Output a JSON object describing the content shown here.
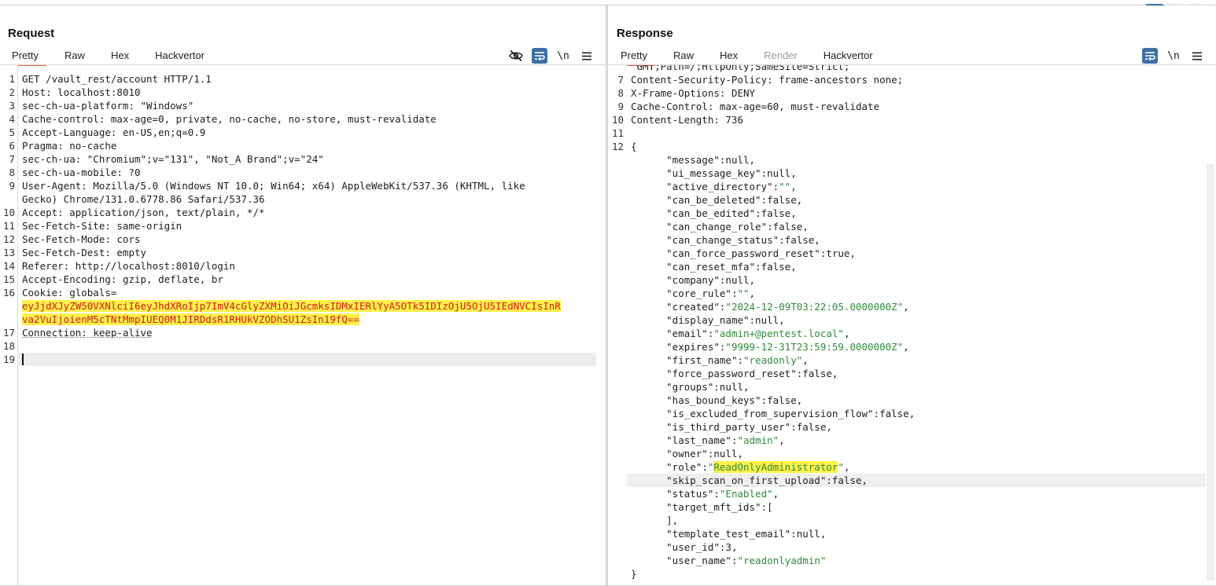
{
  "view_selector": {
    "options": [
      "split-vertical",
      "split-horizontal",
      "single"
    ],
    "active": "split-vertical"
  },
  "request": {
    "title": "Request",
    "tabs": [
      {
        "label": "Pretty",
        "active": true
      },
      {
        "label": "Raw"
      },
      {
        "label": "Hex"
      },
      {
        "label": "Hackvertor"
      }
    ],
    "tools": {
      "hide_icon": "eye-off-icon",
      "wrap_icon": "wrap-lines-icon",
      "newline_label": "\\n",
      "menu_icon": "hamburger-menu-icon"
    },
    "lines": [
      {
        "n": "1",
        "text": "GET /vault_rest/account HTTP/1.1"
      },
      {
        "n": "2",
        "key": "Host",
        "val": ": localhost:8010"
      },
      {
        "n": "3",
        "key": "sec-ch-ua-platform",
        "val": ": \"Windows\""
      },
      {
        "n": "4",
        "key": "Cache-control",
        "val": ": max-age=0, private, no-cache, no-store, must-revalidate"
      },
      {
        "n": "5",
        "key": "Accept-Language",
        "val": ": en-US,en;q=0.9"
      },
      {
        "n": "6",
        "key": "Pragma",
        "val": ": no-cache"
      },
      {
        "n": "7",
        "key": "sec-ch-ua",
        "val": ": \"Chromium\";v=\"131\", \"Not_A Brand\";v=\"24\""
      },
      {
        "n": "8",
        "key": "sec-ch-ua-mobile",
        "val": ": ?0"
      },
      {
        "n": "9",
        "key": "User-Agent",
        "val": ": Mozilla/5.0 (Windows NT 10.0; Win64; x64) AppleWebKit/537.36 (KHTML, like"
      },
      {
        "n": "",
        "text": "Gecko) Chrome/131.0.6778.86 Safari/537.36"
      },
      {
        "n": "10",
        "key": "Accept",
        "val": ": application/json, text/plain, */*"
      },
      {
        "n": "11",
        "key": "Sec-Fetch-Site",
        "val": ": same-origin"
      },
      {
        "n": "12",
        "key": "Sec-Fetch-Mode",
        "val": ": cors"
      },
      {
        "n": "13",
        "key": "Sec-Fetch-Dest",
        "val": ": empty"
      },
      {
        "n": "14",
        "key": "Referer",
        "val": ": http://localhost:8010/login"
      },
      {
        "n": "15",
        "key": "Accept-Encoding",
        "val": ": gzip, deflate, br"
      },
      {
        "n": "16",
        "key": "Cookie",
        "val": ": globals="
      },
      {
        "n": "",
        "cookie": "eyJjdXJyZW50VXNlciI6eyJhdXRoIjp7ImV4cGlyZXMiOiJGcmksIDMxIERlYyA5OTk5IDIzOjU5OjU5IEdNVCIsInR"
      },
      {
        "n": "",
        "cookie": "va2VuIjoienM5cTNtMmpIUEQ0M1JIRDdsR1RHUkVZODhSU1ZsIn19fQ=="
      },
      {
        "n": "17",
        "key": "Connection",
        "val": ": keep-alive",
        "underline": true
      },
      {
        "n": "18",
        "text": ""
      },
      {
        "n": "19",
        "text": "",
        "current": true
      }
    ]
  },
  "response": {
    "title": "Response",
    "tabs": [
      {
        "label": "Pretty",
        "active": true
      },
      {
        "label": "Raw"
      },
      {
        "label": "Hex"
      },
      {
        "label": "Render",
        "disabled": true
      },
      {
        "label": "Hackvertor"
      }
    ],
    "tools": {
      "wrap_icon": "wrap-lines-icon",
      "newline_label": "\\n",
      "menu_icon": "hamburger-menu-icon"
    },
    "lines": [
      {
        "n": "",
        "text": " GMT;Path=/;HttpOnly;SameSite=Strict;"
      },
      {
        "n": "7",
        "key": "Content-Security-Policy",
        "val": ": frame-ancestors none;"
      },
      {
        "n": "8",
        "key": "X-Frame-Options",
        "val": ": DENY"
      },
      {
        "n": "9",
        "key": "Cache-Control",
        "val": ": max-age=60, must-revalidate"
      },
      {
        "n": "10",
        "key": "Content-Length",
        "val": ": 736"
      },
      {
        "n": "11",
        "text": ""
      },
      {
        "n": "12",
        "text": "{"
      },
      {
        "n": "",
        "jk": "\"message\"",
        "jv": ":null,"
      },
      {
        "n": "",
        "jk": "\"ui_message_key\"",
        "jv": ":null,"
      },
      {
        "n": "",
        "jk": "\"active_directory\"",
        "js": "\"\"",
        "jv": ","
      },
      {
        "n": "",
        "jk": "\"can_be_deleted\"",
        "jv": ":false,"
      },
      {
        "n": "",
        "jk": "\"can_be_edited\"",
        "jv": ":false,"
      },
      {
        "n": "",
        "jk": "\"can_change_role\"",
        "jv": ":false,"
      },
      {
        "n": "",
        "jk": "\"can_change_status\"",
        "jv": ":false,"
      },
      {
        "n": "",
        "jk": "\"can_force_password_reset\"",
        "jv": ":true,"
      },
      {
        "n": "",
        "jk": "\"can_reset_mfa\"",
        "jv": ":false,"
      },
      {
        "n": "",
        "jk": "\"company\"",
        "jv": ":null,"
      },
      {
        "n": "",
        "jk": "\"core_rule\"",
        "js": "\"\"",
        "jv": ","
      },
      {
        "n": "",
        "jk": "\"created\"",
        "js": "\"2024-12-09T03:22:05.0000000Z\"",
        "jv": ","
      },
      {
        "n": "",
        "jk": "\"display_name\"",
        "jv": ":null,"
      },
      {
        "n": "",
        "jk": "\"email\"",
        "js": "\"admin+@pentest.local\"",
        "jv": ","
      },
      {
        "n": "",
        "jk": "\"expires\"",
        "js": "\"9999-12-31T23:59:59.0000000Z\"",
        "jv": ","
      },
      {
        "n": "",
        "jk": "\"first_name\"",
        "js": "\"readonly\"",
        "jv": ","
      },
      {
        "n": "",
        "jk": "\"force_password_reset\"",
        "jv": ":false,"
      },
      {
        "n": "",
        "jk": "\"groups\"",
        "jv": ":null,"
      },
      {
        "n": "",
        "jk": "\"has_bound_keys\"",
        "jv": ":false,"
      },
      {
        "n": "",
        "jk": "\"is_excluded_from_supervision_flow\"",
        "jv": ":false,"
      },
      {
        "n": "",
        "jk": "\"is_third_party_user\"",
        "jv": ":false,"
      },
      {
        "n": "",
        "jk": "\"last_name\"",
        "js": "\"admin\"",
        "jv": ","
      },
      {
        "n": "",
        "jk": "\"owner\"",
        "jv": ":null,"
      },
      {
        "n": "",
        "jk": "\"role\"",
        "jsq": "ReadOnlyAdministrator",
        "highlight": true,
        "jv": ","
      },
      {
        "n": "",
        "jk": "\"skip_scan_on_first_upload\"",
        "jv": ":false,",
        "current": true
      },
      {
        "n": "",
        "jk": "\"status\"",
        "js": "\"Enabled\"",
        "jv": ","
      },
      {
        "n": "",
        "jk": "\"target_mft_ids\"",
        "jv": ":["
      },
      {
        "n": "",
        "text": "      ],"
      },
      {
        "n": "",
        "jk": "\"template_test_email\"",
        "jv": ":null,"
      },
      {
        "n": "",
        "jk": "\"user_id\"",
        "jv": ":3,"
      },
      {
        "n": "",
        "jk": "\"user_name\"",
        "js": "\"readonlyadmin\"",
        "jv": ""
      },
      {
        "n": "",
        "text": "}"
      }
    ]
  }
}
